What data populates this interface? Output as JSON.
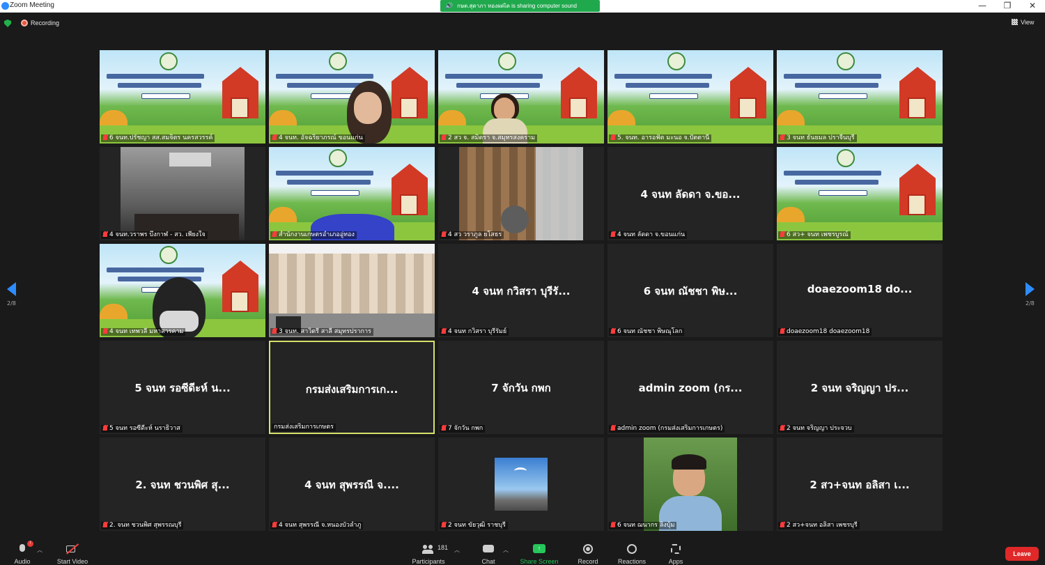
{
  "window": {
    "title": "Zoom Meeting",
    "minimize": "—",
    "restore": "❐",
    "close": "✕"
  },
  "share_banner": "กษต.สุดาภา ทองผดเิด is sharing computer sound",
  "recording_label": "Recording",
  "view_label": "View",
  "pager": {
    "left": "2/8",
    "right": "2/8"
  },
  "tiles": [
    {
      "name": "6 จนท.ปรัชญา สส.สมจิตร นครสวรรค์",
      "display": "",
      "type": "farm",
      "muted": true
    },
    {
      "name": "4 จนท. อัจฉริยาภรณ์ ขอนแก่น",
      "display": "",
      "type": "farm-person",
      "muted": true
    },
    {
      "name": "2 สว จ. สมิตรา จ.สมุทรสงคราม",
      "display": "",
      "type": "farm-person2",
      "muted": true
    },
    {
      "name": "5. จนท. อารอฟัต มะนอ จ.ปัตตานี",
      "display": "",
      "type": "farm",
      "muted": true
    },
    {
      "name": "3 จนท ธันยมล ปราจีนบุรี",
      "display": "",
      "type": "farm",
      "muted": true
    },
    {
      "name": "4 จนท.วราพร บึงกาฬ - สว. เพียงใจ",
      "display": "",
      "type": "ceiling",
      "muted": true
    },
    {
      "name": "สำนักงานเกษตรอำเภออู่ทอง",
      "display": "",
      "type": "farm-hand",
      "muted": true
    },
    {
      "name": "4 สว วราภูล ยโสธร",
      "display": "",
      "type": "wood",
      "muted": true
    },
    {
      "name": "4 จนท ลัดดา จ.ขอนแก่น",
      "display": "4 จนท ลัดดา จ.ขอ...",
      "type": "blank",
      "muted": true
    },
    {
      "name": "6 สว+ จนท เพชรบูรณ์",
      "display": "",
      "type": "farm",
      "muted": true
    },
    {
      "name": "4 จนท เทพวลี มหาสารคาม",
      "display": "",
      "type": "farm-person3",
      "muted": true
    },
    {
      "name": "3 จนท. สาวิตรี สาลี สมุทรปราการ",
      "display": "",
      "type": "curtain",
      "muted": true
    },
    {
      "name": "4 จนท กวิสรา บุรีรัมย์",
      "display": "4 จนท กวิสรา บุรีรั...",
      "type": "blank",
      "muted": true
    },
    {
      "name": "6 จนท ณัชชา พิษณุโลก",
      "display": "6 จนท ณัชชา พิษ...",
      "type": "blank",
      "muted": true
    },
    {
      "name": "doaezoom18 doaezoom18",
      "display": "doaezoom18  do...",
      "type": "blank",
      "muted": true
    },
    {
      "name": "5 จนท รอซีดีะห์ นราธิวาส",
      "display": "5 จนท รอซีดีะห์ น...",
      "type": "blank",
      "muted": true
    },
    {
      "name": "กรมส่งเสริมการเกษตร",
      "display": "กรมส่งเสริมการเก...",
      "type": "blank",
      "muted": false,
      "active": true
    },
    {
      "name": "7 จักวัน กพก",
      "display": "7 จักวัน กพก",
      "type": "blank",
      "muted": true
    },
    {
      "name": "admin zoom (กรมส่งเสริมการเกษตร)",
      "display": "admin zoom (กร...",
      "type": "blank",
      "muted": true
    },
    {
      "name": "2 จนท จริญญา ประจวบ",
      "display": "2 จนท จริญญา ปร...",
      "type": "blank",
      "muted": true
    },
    {
      "name": "2. จนท ชวนพิศ สุพรรณบุรี",
      "display": "2. จนท ชวนพิศ สุ...",
      "type": "blank",
      "muted": true
    },
    {
      "name": "4 จนท สุพรรณี จ.หนองบัวลำภู",
      "display": "4 จนท สุพรรณี จ....",
      "type": "blank",
      "muted": true
    },
    {
      "name": "2 จนท ขัยวุฒิ ราชบุรี",
      "display": "",
      "type": "bird",
      "muted": true
    },
    {
      "name": "6 จนท ฌนากร ลิงบุ้ม",
      "display": "",
      "type": "man",
      "muted": true
    },
    {
      "name": "2 สว+จนท อลิสา เพชรบุรี",
      "display": "2 สว+จนท อลิสา เ...",
      "type": "blank",
      "muted": true
    }
  ],
  "toolbar": {
    "audio": "Audio",
    "audio_badge": "!",
    "start_video": "Start Video",
    "participants": "Participants",
    "participants_count": "181",
    "chat": "Chat",
    "share_screen": "Share Screen",
    "record": "Record",
    "reactions": "Reactions",
    "apps": "Apps",
    "leave": "Leave"
  },
  "colors": {
    "accent_blue": "#2d8cff",
    "share_green": "#20a84d",
    "active_border": "#d8e26b",
    "leave_red": "#e02828"
  }
}
